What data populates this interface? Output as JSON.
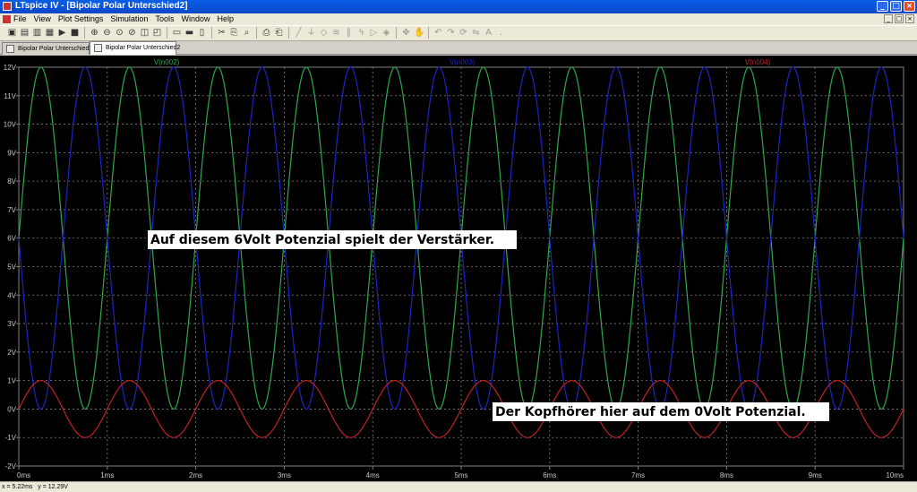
{
  "window": {
    "title": "LTspice IV - [Bipolar Polar Unterschied2]",
    "buttons": [
      "_",
      "□",
      "×"
    ]
  },
  "menu": [
    "File",
    "View",
    "Plot Settings",
    "Simulation",
    "Tools",
    "Window",
    "Help"
  ],
  "mdi_buttons": [
    "_",
    "□",
    "×"
  ],
  "toolbar_icons": [
    "new-schematic-icon",
    "open-icon",
    "save-icon",
    "control-panel-icon",
    "run-icon",
    "halt-icon",
    "zoom-in-icon",
    "zoom-out-icon",
    "zoom-fit-icon",
    "zoom-cancel-icon",
    "autorange-icon",
    "scale-icon",
    "tile-horizontal-icon",
    "cascade-icon",
    "tile-vertical-icon",
    "cut-icon",
    "copy-icon",
    "find-icon",
    "print-icon",
    "print-setup-icon",
    "wire-icon",
    "ground-icon",
    "label-icon",
    "resistor-icon",
    "capacitor-icon",
    "inductor-icon",
    "diode-icon",
    "component-icon",
    "move-icon",
    "drag-icon",
    "undo-icon",
    "redo-icon",
    "rotate-icon",
    "mirror-icon",
    "text-icon",
    "spice-directive-icon"
  ],
  "tabs": [
    {
      "label": "Bipolar Polar Unterschied2",
      "active": false
    },
    {
      "label": "Bipolar Polar Unterschied2",
      "active": true
    }
  ],
  "status": {
    "x": "x = 5.22ms",
    "y": "y = 12.29V"
  },
  "colors": {
    "background": "#000000",
    "grid": "#808080",
    "axis_text": "#c8c8c8",
    "green": "#2ea84c",
    "blue": "#1c25c4",
    "red": "#c22222"
  },
  "chart_data": {
    "type": "line",
    "x_unit": "ms",
    "y_unit": "V",
    "xlim": [
      0,
      10
    ],
    "ylim": [
      -2,
      12
    ],
    "x_ticks": [
      "0ms",
      "1ms",
      "2ms",
      "3ms",
      "4ms",
      "5ms",
      "6ms",
      "7ms",
      "8ms",
      "9ms",
      "10ms"
    ],
    "y_ticks": [
      "-2V",
      "-1V",
      "0V",
      "1V",
      "2V",
      "3V",
      "4V",
      "5V",
      "6V",
      "7V",
      "8V",
      "9V",
      "10V",
      "11V",
      "12V"
    ],
    "grid": true,
    "series": [
      {
        "name": "V(n002)",
        "color": "#2ea84c",
        "kind": "sine",
        "offset": 6,
        "amplitude": 6,
        "frequency_khz": 1,
        "phase_deg": 0
      },
      {
        "name": "V(n003)",
        "color": "#1c25c4",
        "kind": "sine",
        "offset": 6,
        "amplitude": 6,
        "frequency_khz": 1,
        "phase_deg": 180
      },
      {
        "name": "V(n004)",
        "color": "#c22222",
        "kind": "sine",
        "offset": 0,
        "amplitude": 1,
        "frequency_khz": 1,
        "phase_deg": 0
      }
    ],
    "annotations": [
      "Auf diesem 6Volt Potenzial spielt der Verstärker.",
      "Der Kopfhörer hier auf dem 0Volt Potenzial."
    ]
  }
}
